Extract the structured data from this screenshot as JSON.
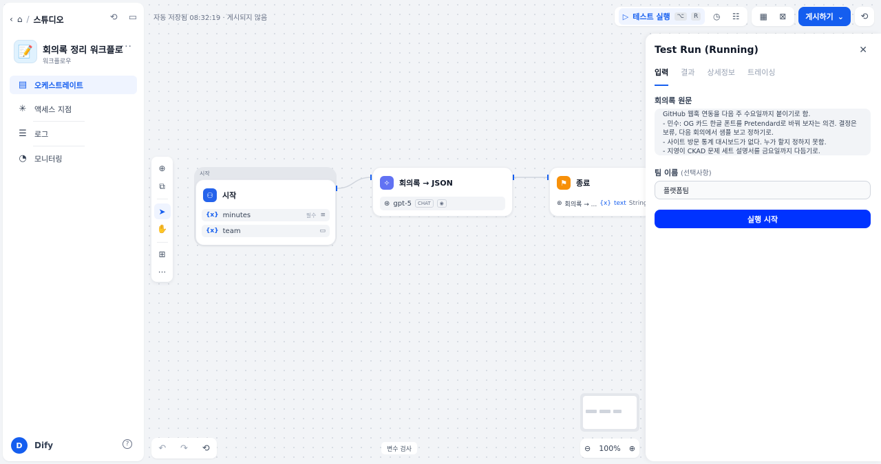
{
  "sidebar": {
    "breadcrumb_sep": "/",
    "breadcrumb_label": "스튜디오",
    "app": {
      "emoji": "📝",
      "title": "회의록 정리 워크플로",
      "subtitle": "워크플로우",
      "more": "···"
    },
    "nav": [
      {
        "label": "오케스트레이트",
        "icon": "layout-icon"
      },
      {
        "label": "액세스 지점",
        "icon": "access-icon"
      },
      {
        "label": "로그",
        "icon": "log-icon"
      },
      {
        "label": "모니터링",
        "icon": "monitor-icon"
      }
    ],
    "user": {
      "initial": "D",
      "name": "Dify"
    }
  },
  "topbar": {
    "autosave": "자동 저장됨 08:32:19 · 게시되지 않음",
    "test_run_label": "테스트 실행",
    "test_run_key1": "⌥",
    "test_run_key2": "R",
    "publish_label": "게시하기"
  },
  "nodes": {
    "start": {
      "wrapper_label": "시작",
      "title": "시작",
      "vars": [
        {
          "name": "minutes",
          "badge": "필수"
        },
        {
          "name": "team"
        }
      ]
    },
    "llm": {
      "title": "회의록 → JSON",
      "model": "gpt-5",
      "mode": "CHAT"
    },
    "end": {
      "title": "종료",
      "out_source": "회의록 → ...",
      "out_var": "text",
      "out_type": "String"
    }
  },
  "bottom": {
    "variable_check": "변수 검사",
    "zoom": "100%"
  },
  "panel": {
    "title": "Test Run (Running)",
    "tabs": [
      "입력",
      "결과",
      "상세정보",
      "트레이싱"
    ],
    "minutes_label": "회의록 원문",
    "minutes_value": "GitHub 웹훅 연동을 다음 주 수요일까지 붙이기로 함.\n- 민수: OG 카드 한글 폰트를 Pretendard로 바꿔 보자는 의견. 결정은 보류, 다음 회의에서 샘플 보고 정하기로.\n- 사이트 방문 통계 대시보드가 없다. 누가 할지 정하지 못함.\n- 지영이 CKAD 문제 세트 설명서를 금요일까지 다듬기로.",
    "team_label": "팀 이름",
    "team_optional": "(선택사항)",
    "team_value": "플랫폼팀",
    "run_button": "실행 시작"
  },
  "colors": {
    "accent": "#155eef",
    "run_button": "#0033ff",
    "start_node_icon": "#2563eb",
    "llm_node_icon": "#6172f3",
    "end_node_icon": "#f79009"
  }
}
